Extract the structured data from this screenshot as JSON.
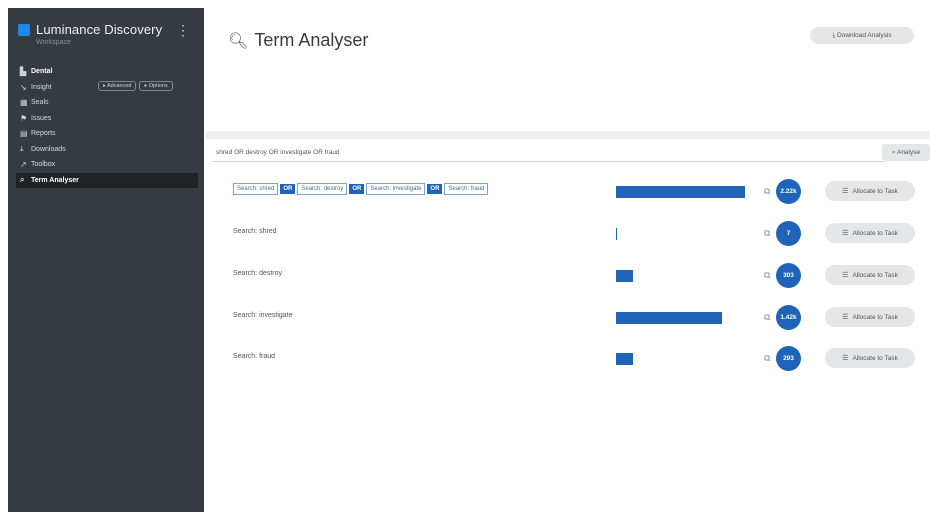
{
  "app": {
    "name": "Luminance Discovery",
    "subtitle": "Workspace",
    "menu_glyph": "⋮"
  },
  "nav": [
    {
      "label": "Dental",
      "icon": "bar-chart-icon",
      "glyph": "▙"
    },
    {
      "label": "Insight",
      "icon": "trend-icon",
      "glyph": "↘"
    },
    {
      "label": "Seals",
      "icon": "grid-icon",
      "glyph": "▦"
    },
    {
      "label": "Issues",
      "icon": "flag-icon",
      "glyph": "⚑"
    },
    {
      "label": "Reports",
      "icon": "report-icon",
      "glyph": "▤"
    },
    {
      "label": "Downloads",
      "icon": "download-icon",
      "glyph": "⤓"
    },
    {
      "label": "Toolbox",
      "icon": "wrench-icon",
      "glyph": "↗"
    },
    {
      "label": "Term Analyser",
      "icon": "search-icon",
      "glyph": "⌕"
    }
  ],
  "nav_pills": [
    "▸ Advanced",
    "▸ Options"
  ],
  "page": {
    "title": "Term Analyser",
    "title_icon_glyph": "🔍︎",
    "download_label": "⤓ Download Analysis"
  },
  "query": {
    "value": "shred OR destroy OR investigate OR fraud",
    "analyse_label": "⌕ Analyse"
  },
  "combined": {
    "chips": [
      "Search: shred",
      "Search: destroy",
      "Search: investigate",
      "Search: fraud"
    ],
    "operator": "OR",
    "bar_fraction": 0.92,
    "count": "2.22k"
  },
  "terms": [
    {
      "label": "Search: shred",
      "bar_fraction": 0.01,
      "count": "7"
    },
    {
      "label": "Search: destroy",
      "bar_fraction": 0.12,
      "count": "303"
    },
    {
      "label": "Search: investigate",
      "bar_fraction": 0.76,
      "count": "1.42k"
    },
    {
      "label": "Search: fraud",
      "bar_fraction": 0.12,
      "count": "293"
    }
  ],
  "allocate_label": "Allocate to Task",
  "allocate_glyph": "☰",
  "copy_glyph": "⧉",
  "colors": {
    "sidebar": "#353b40",
    "accent": "#1f64b8",
    "button": "#e4e6e8"
  }
}
